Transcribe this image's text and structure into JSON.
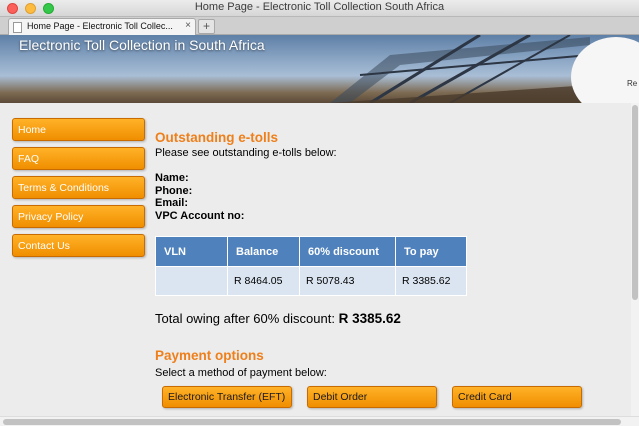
{
  "window": {
    "title": "Home Page - Electronic Toll Collection South Africa"
  },
  "tabs": [
    {
      "label": "Home Page - Electronic Toll Collec...",
      "close": "×"
    }
  ],
  "new_tab": "+",
  "banner": {
    "title": "Electronic Toll Collection in South Africa",
    "logo_text": "Re"
  },
  "nav": {
    "items": [
      {
        "label": "Home"
      },
      {
        "label": "FAQ"
      },
      {
        "label": "Terms & Conditions"
      },
      {
        "label": "Privacy Policy"
      },
      {
        "label": "Contact Us"
      }
    ]
  },
  "outstanding": {
    "heading": "Outstanding e-tolls",
    "intro": "Please see outstanding e-tolls below:",
    "fields": {
      "name": "Name:",
      "phone": "Phone:",
      "email": "Email:",
      "vpc": "VPC Account no:"
    }
  },
  "table": {
    "headers": [
      "VLN",
      "Balance",
      "60% discount",
      "To pay"
    ],
    "rows": [
      [
        "",
        "R 8464.05",
        "R 5078.43",
        "R 3385.62"
      ]
    ]
  },
  "total": {
    "label": "Total owing after 60% discount:",
    "amount": "R 3385.62"
  },
  "payment": {
    "heading": "Payment options",
    "intro": "Select a method of payment below:",
    "buttons": [
      {
        "label": "Electronic Transfer (EFT)"
      },
      {
        "label": "Debit Order"
      },
      {
        "label": "Credit Card"
      }
    ]
  },
  "colors": {
    "accent_orange": "#f08e00",
    "heading_orange": "#ee7f1a",
    "table_header": "#4f81bd",
    "table_cell": "#dbe5f1"
  }
}
